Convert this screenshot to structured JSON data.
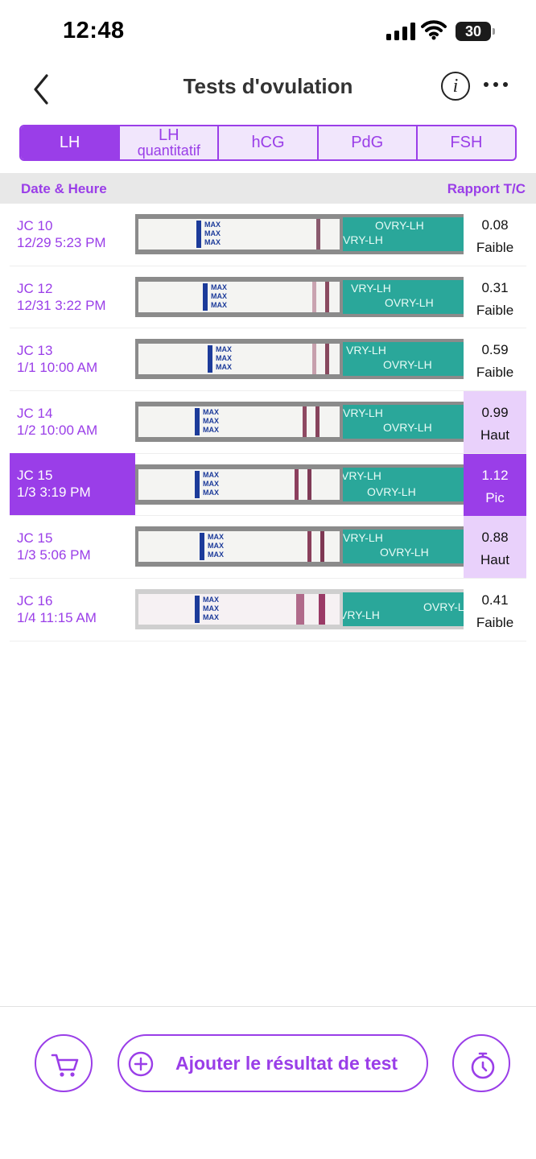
{
  "status": {
    "time": "12:48",
    "battery": "30"
  },
  "nav": {
    "title": "Tests d'ovulation"
  },
  "tabs": [
    {
      "label": "LH",
      "sub": ""
    },
    {
      "label": "LH",
      "sub": "quantitatif"
    },
    {
      "label": "hCG",
      "sub": ""
    },
    {
      "label": "PdG",
      "sub": ""
    },
    {
      "label": "FSH",
      "sub": ""
    }
  ],
  "table": {
    "date_header": "Date & Heure",
    "ratio_header": "Rapport T/C",
    "rows": [
      {
        "day": "JC 10",
        "datetime": "12/29 5:23 PM",
        "ratio": "0.08",
        "level": "Faible"
      },
      {
        "day": "JC 12",
        "datetime": "12/31 3:22 PM",
        "ratio": "0.31",
        "level": "Faible"
      },
      {
        "day": "JC 13",
        "datetime": "1/1 10:00 AM",
        "ratio": "0.59",
        "level": "Faible"
      },
      {
        "day": "JC 14",
        "datetime": "1/2 10:00 AM",
        "ratio": "0.99",
        "level": "Haut"
      },
      {
        "day": "JC 15",
        "datetime": "1/3 3:19 PM",
        "ratio": "1.12",
        "level": "Pic"
      },
      {
        "day": "JC 15",
        "datetime": "1/3 5:06 PM",
        "ratio": "0.88",
        "level": "Haut"
      },
      {
        "day": "JC 16",
        "datetime": "1/4 11:15 AM",
        "ratio": "0.41",
        "level": "Faible"
      }
    ]
  },
  "strip_text": {
    "max": "MAX",
    "brand": "OVRY-LH",
    "brand_cut": "VRY-LH"
  },
  "bottom": {
    "add_label": "Ajouter le résultat de test"
  },
  "colors": {
    "accent": "#9a3ee8",
    "accent_light": "#e9d1fb",
    "strip_teal": "#2aa79a"
  }
}
